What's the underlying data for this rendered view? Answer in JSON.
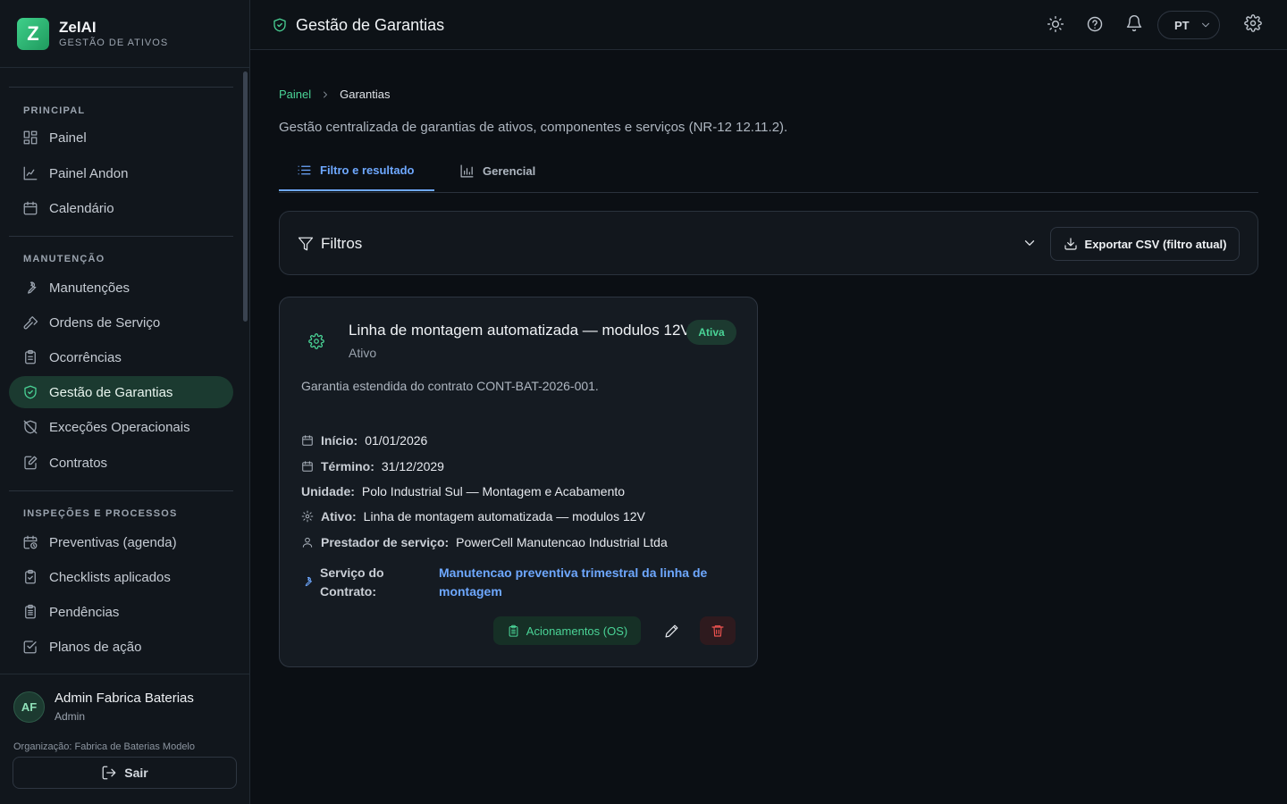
{
  "brand": {
    "logo_letter": "Z",
    "name": "ZelAI",
    "subtitle": "GESTÃO DE ATIVOS"
  },
  "sidebar": {
    "sections": [
      {
        "title": "PRINCIPAL",
        "items": [
          {
            "label": "Painel",
            "icon": "dashboard-icon"
          },
          {
            "label": "Painel Andon",
            "icon": "chart-icon"
          },
          {
            "label": "Calendário",
            "icon": "calendar-icon"
          }
        ]
      },
      {
        "title": "MANUTENÇÃO",
        "items": [
          {
            "label": "Manutenções",
            "icon": "wrench-icon"
          },
          {
            "label": "Ordens de Serviço",
            "icon": "hammer-icon"
          },
          {
            "label": "Ocorrências",
            "icon": "clipboard-icon"
          },
          {
            "label": "Gestão de Garantias",
            "icon": "shield-check-icon",
            "active": true
          },
          {
            "label": "Exceções Operacionais",
            "icon": "shield-off-icon"
          },
          {
            "label": "Contratos",
            "icon": "document-edit-icon"
          }
        ]
      },
      {
        "title": "INSPEÇÕES E PROCESSOS",
        "items": [
          {
            "label": "Preventivas (agenda)",
            "icon": "calendar-clock-icon"
          },
          {
            "label": "Checklists aplicados",
            "icon": "clipboard-check-icon"
          },
          {
            "label": "Pendências",
            "icon": "clipboard-list-icon"
          },
          {
            "label": "Planos de ação",
            "icon": "checkbox-icon"
          }
        ]
      }
    ]
  },
  "user": {
    "initials": "AF",
    "name": "Admin Fabrica Baterias",
    "role": "Admin",
    "organization": "Organização: Fabrica de Baterias Modelo",
    "logout_label": "Sair"
  },
  "topbar": {
    "title": "Gestão de Garantias",
    "language": "PT",
    "icons": [
      "sun-icon",
      "help-icon",
      "bell-icon",
      "gear-icon"
    ]
  },
  "breadcrumb": {
    "root": "Painel",
    "current": "Garantias"
  },
  "page": {
    "description": "Gestão centralizada de garantias de ativos, componentes e serviços (NR-12 12.11.2)."
  },
  "tabs": [
    {
      "label": "Filtro e resultado",
      "active": true
    },
    {
      "label": "Gerencial",
      "active": false
    }
  ],
  "filters": {
    "title": "Filtros",
    "export_label": "Exportar CSV (filtro atual)"
  },
  "warranty_card": {
    "title": "Linha de montagem automatizada — modulos 12V",
    "subtitle": "Ativo",
    "status": "Ativa",
    "description": "Garantia estendida do contrato CONT-BAT-2026-001.",
    "start_label": "Início:",
    "start_value": "01/01/2026",
    "end_label": "Término:",
    "end_value": "31/12/2029",
    "unit_label": "Unidade:",
    "unit_value": "Polo Industrial Sul — Montagem e Acabamento",
    "asset_label": "Ativo:",
    "asset_value": "Linha de montagem automatizada — modulos 12V",
    "provider_label": "Prestador de serviço:",
    "provider_value": "PowerCell Manutencao Industrial Ltda",
    "service_label": "Serviço do Contrato:",
    "service_value": "Manutencao preventiva trimestral da linha de montagem",
    "os_button_label": "Acionamentos (OS)"
  },
  "colors": {
    "accent_green": "#4ad396",
    "accent_blue": "#6ea8ff",
    "danger": "#ef5350",
    "background": "#0b0f14"
  }
}
